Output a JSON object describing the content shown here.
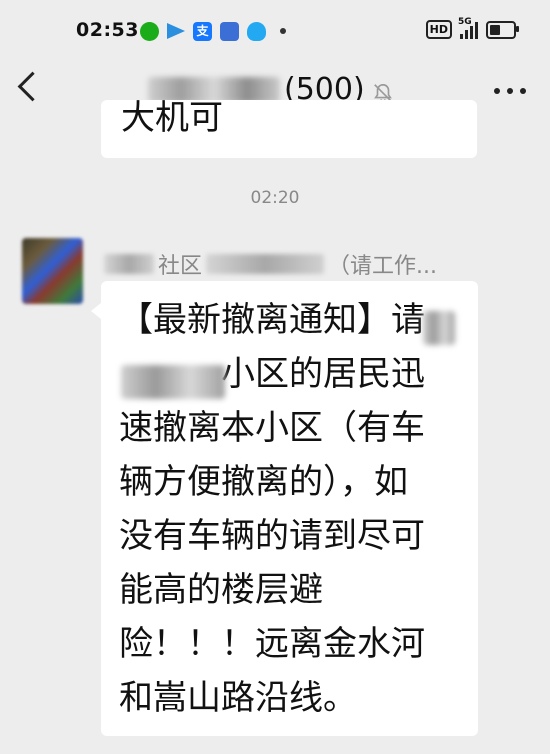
{
  "status_bar": {
    "time": "02:53",
    "alipay_glyph": "支",
    "hd_label": "HD",
    "network_label": "5G",
    "battery_level": 0.55,
    "notification_icons": [
      "wechat-icon",
      "send-icon",
      "alipay-icon",
      "app-icon",
      "qq-icon"
    ]
  },
  "header": {
    "title_visible": "(500)",
    "title_partial": "",
    "muted": true
  },
  "prev_message": {
    "partial_text": "大机可"
  },
  "timestamp": "02:20",
  "sender": {
    "name_visible": "社区",
    "name_suffix": "（请工作..."
  },
  "message": {
    "text": "【最新撤离通知】请\n小区的居民迅速撤离本小区（有车辆方便撤离的），如没有车辆的请到尽可能高的楼层避险！！！远离金水河和嵩山路沿线。",
    "lines": [
      "【最新撤离通知】请",
      "　　　小区的居民迅",
      "速撤离本小区（有车",
      "辆方便撤离的），如",
      "没有车辆的请到尽可",
      "能高的楼层避",
      "险！！！远离金水河",
      "和嵩山路沿线。"
    ]
  },
  "colors": {
    "background": "#ededed",
    "bubble": "#ffffff",
    "muted_text": "#888888"
  }
}
